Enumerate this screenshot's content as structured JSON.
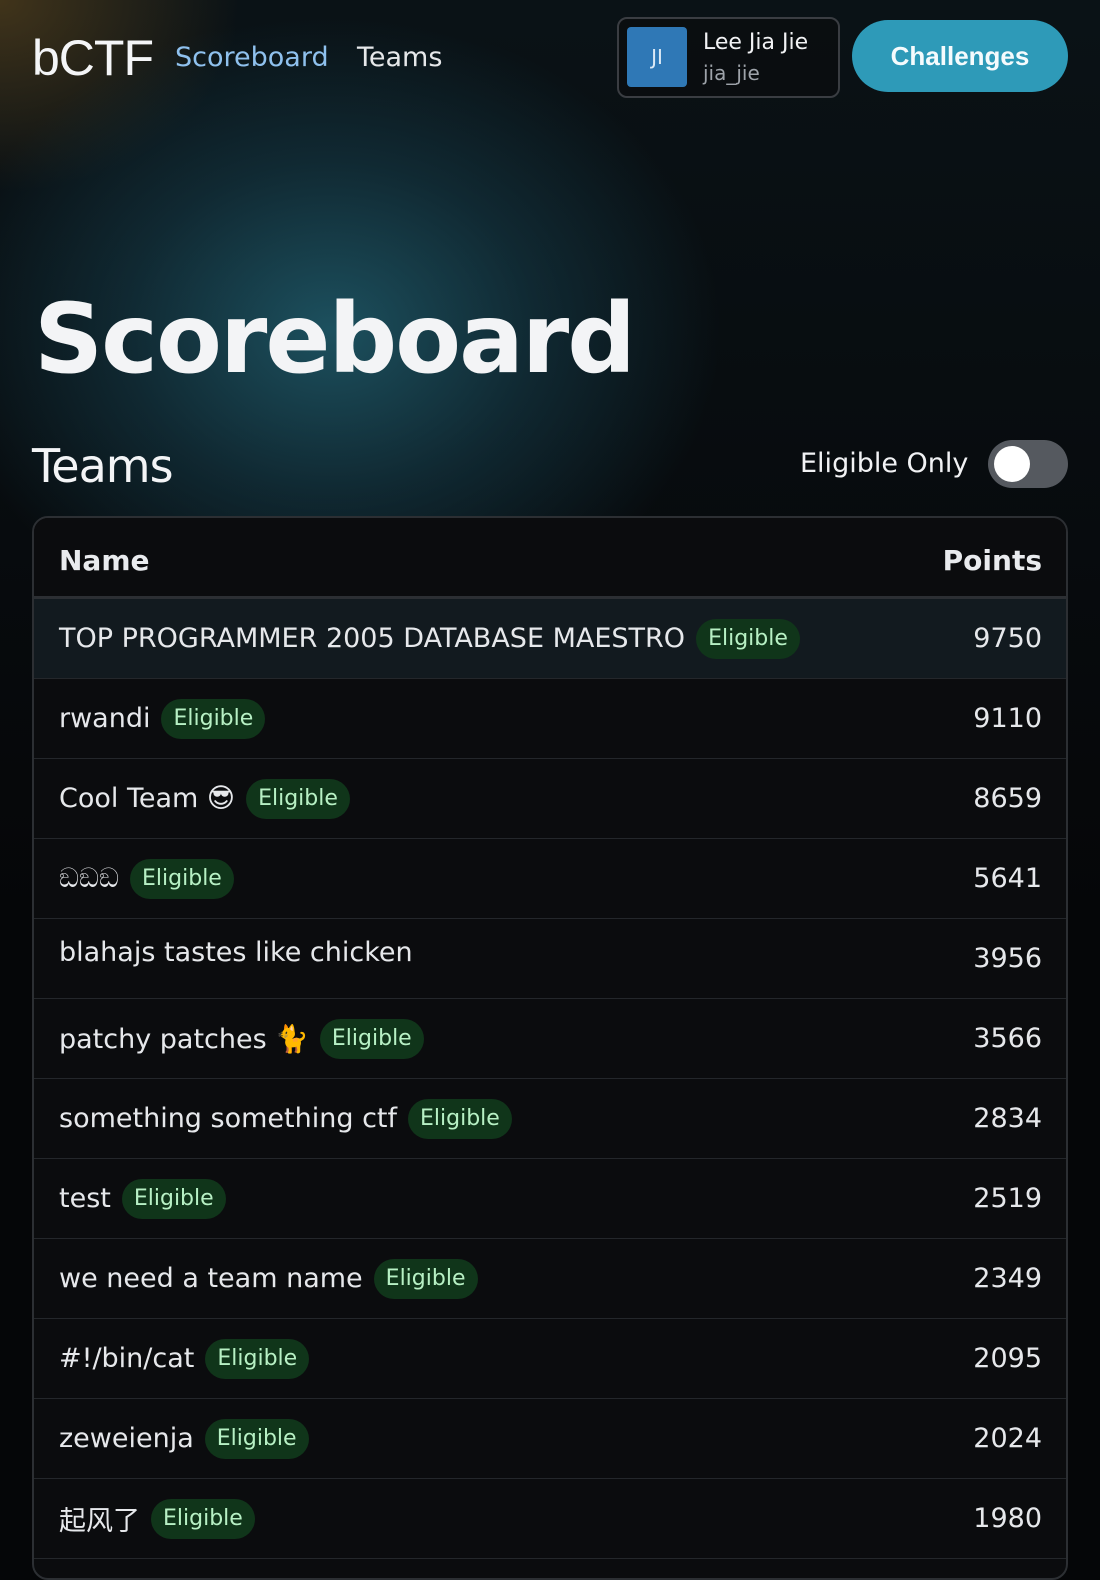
{
  "header": {
    "brand": "bCTF",
    "nav": {
      "scoreboard": "Scoreboard",
      "teams": "Teams"
    },
    "user": {
      "initials": "JI",
      "name": "Lee Jia Jie",
      "handle": "jia_jie"
    },
    "challenges_button": "Challenges"
  },
  "page": {
    "title": "Scoreboard",
    "section_title": "Teams",
    "filter_label": "Eligible Only",
    "filter_enabled": false
  },
  "table": {
    "columns": {
      "name": "Name",
      "points": "Points"
    },
    "badge_label": "Eligible",
    "rows": [
      {
        "name": "TOP PROGRAMMER 2005 DATABASE MAESTRO",
        "eligible": true,
        "points": "9750"
      },
      {
        "name": "rwandi",
        "eligible": true,
        "points": "9110"
      },
      {
        "name": "Cool Team 😎",
        "eligible": true,
        "points": "8659"
      },
      {
        "name": "ඞඞඞ",
        "eligible": true,
        "points": "5641"
      },
      {
        "name": "blahajs tastes like chicken",
        "eligible": false,
        "points": "3956"
      },
      {
        "name": "patchy patches 🐈",
        "eligible": true,
        "points": "3566"
      },
      {
        "name": "something something ctf",
        "eligible": true,
        "points": "2834"
      },
      {
        "name": "test",
        "eligible": true,
        "points": "2519"
      },
      {
        "name": "we need a team name",
        "eligible": true,
        "points": "2349"
      },
      {
        "name": "#!/bin/cat",
        "eligible": true,
        "points": "2095"
      },
      {
        "name": "zeweienja",
        "eligible": true,
        "points": "2024"
      },
      {
        "name": "起风了",
        "eligible": true,
        "points": "1980"
      }
    ]
  },
  "colors": {
    "accent": "#2e9ab8",
    "nav_active": "#8fc1ee",
    "badge_bg": "#10351a",
    "badge_text": "#b7f0c4"
  }
}
